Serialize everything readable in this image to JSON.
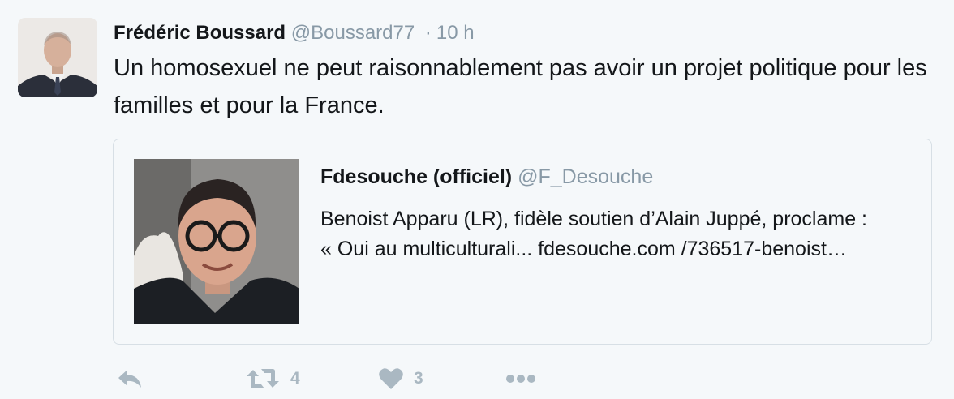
{
  "tweet": {
    "author_name": "Frédéric Boussard",
    "author_handle": "@Boussard77",
    "separator": "·",
    "time": "10 h",
    "text": "Un homosexuel ne peut raisonnablement pas avoir un projet politique pour les familles et pour la France."
  },
  "quoted_tweet": {
    "author_name": "Fdesouche (officiel)",
    "author_handle": "@F_Desouche",
    "text": "Benoist Apparu (LR), fidèle soutien d’Alain Juppé, proclame : « Oui au multiculturali... fdesouche.com /736517-benoist…"
  },
  "actions": {
    "reply": {
      "icon": "reply-icon"
    },
    "retweet": {
      "icon": "retweet-icon",
      "count": "4"
    },
    "like": {
      "icon": "heart-icon",
      "count": "3"
    },
    "more": {
      "icon": "more-icon"
    }
  },
  "colors": {
    "background": "#f5f8fa",
    "text": "#14171a",
    "secondary_text": "#8899a6",
    "action_icon": "#aab8c2",
    "card_border": "#d7dfe5"
  }
}
